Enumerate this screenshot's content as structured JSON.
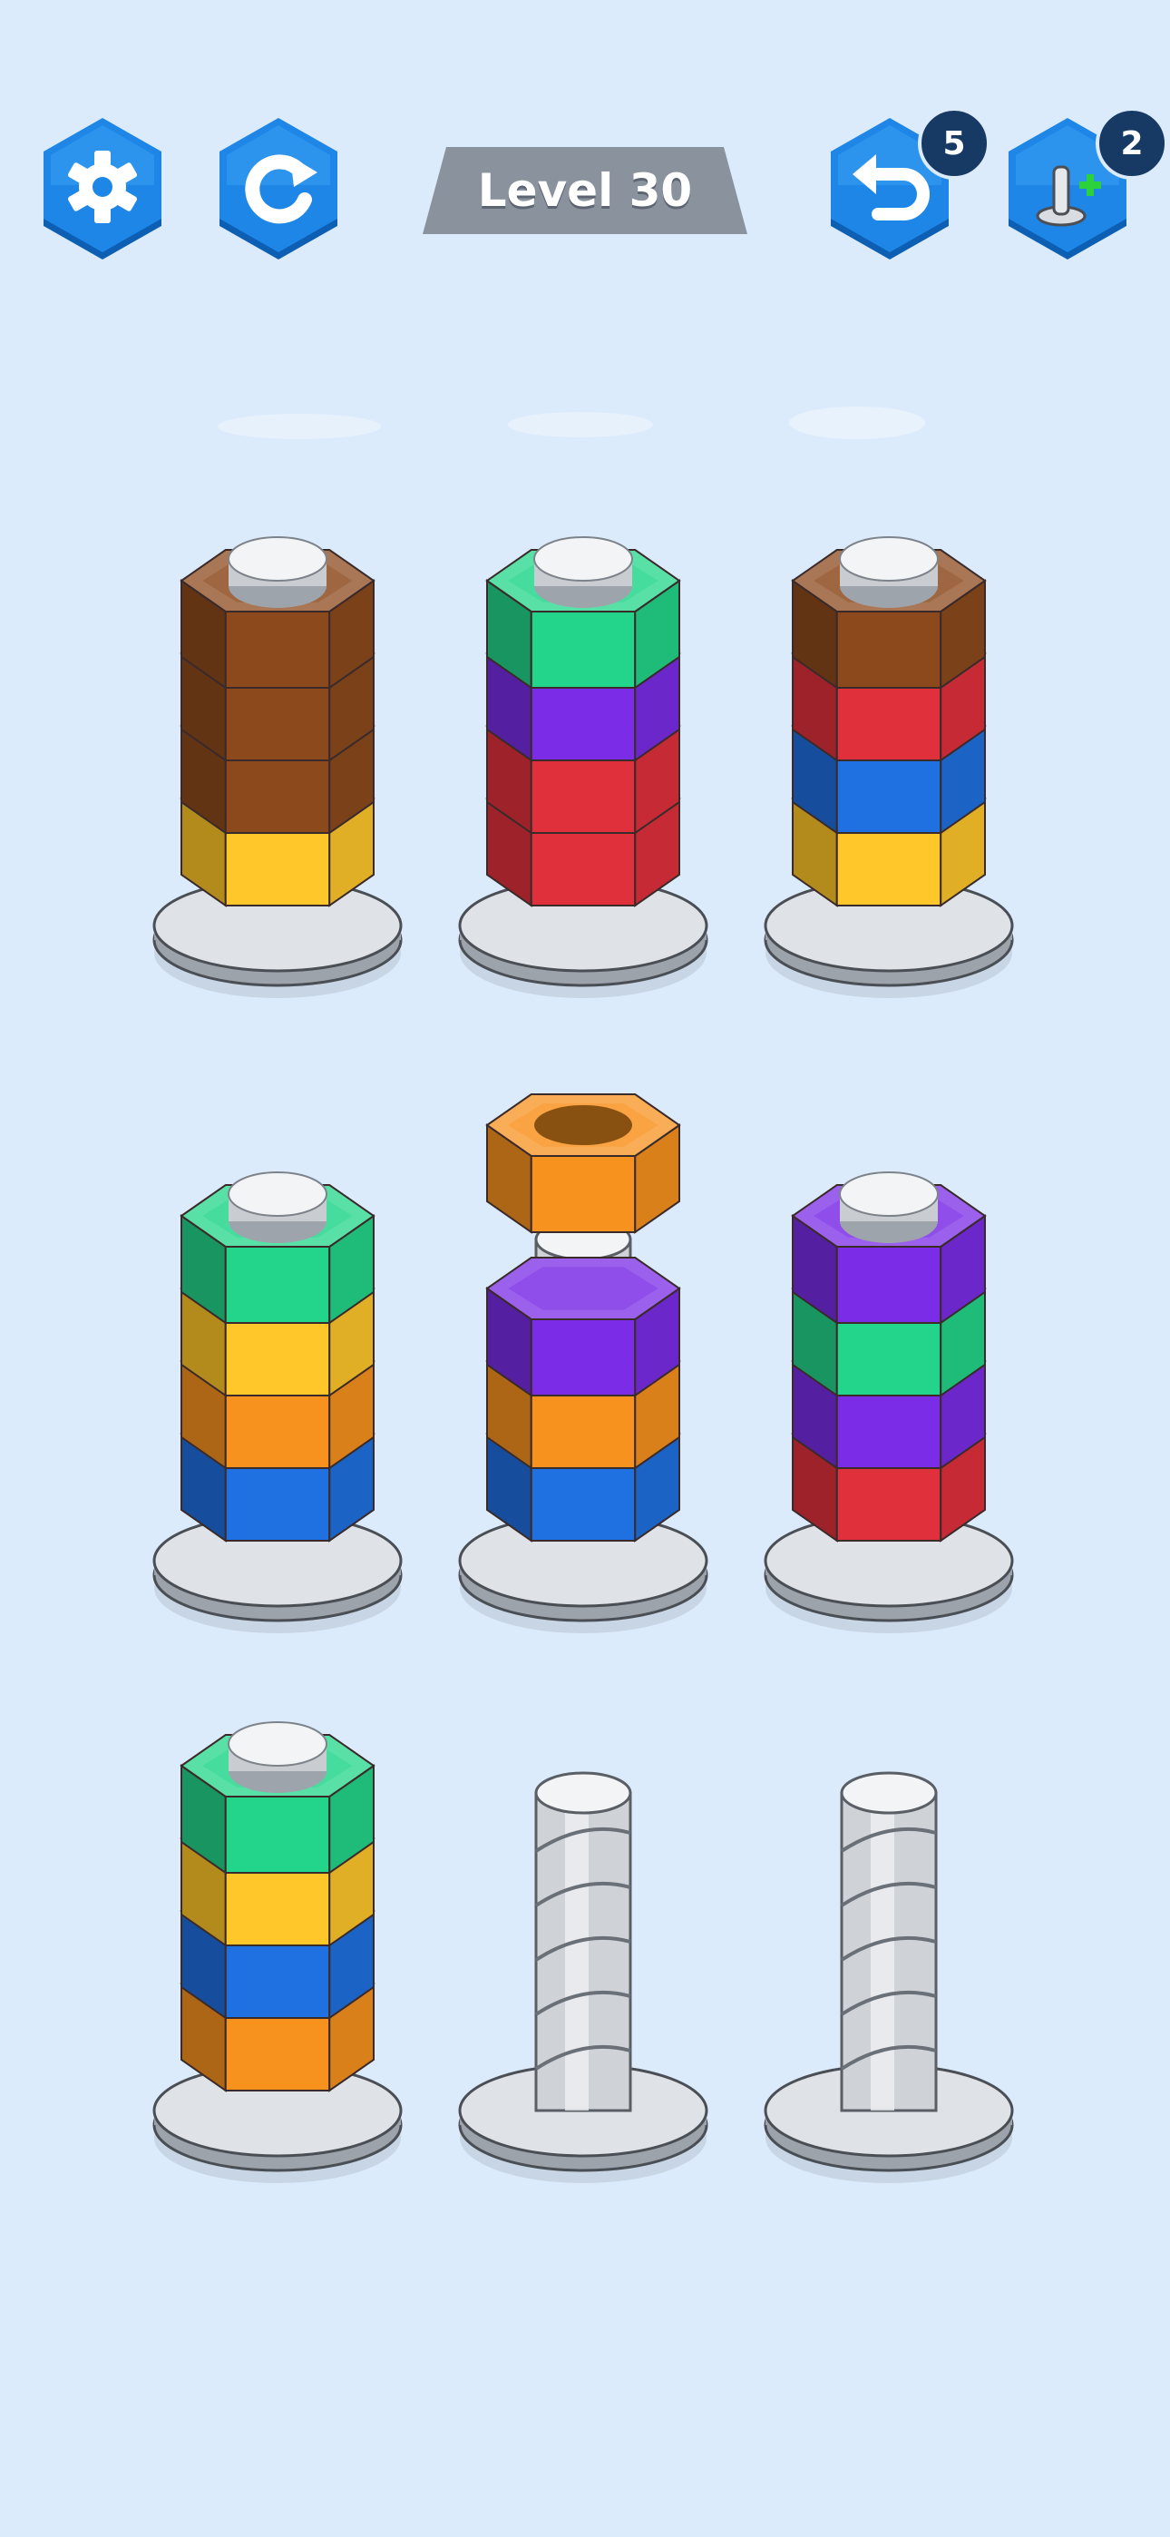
{
  "hud": {
    "settings_icon": "gear-icon",
    "restart_icon": "restart-icon",
    "undo_icon": "undo-icon",
    "undo_count": "5",
    "add_screw_icon": "add-screw-icon",
    "add_screw_count": "2",
    "level_label": "Level 30"
  },
  "colors": {
    "background": "#dcebfb",
    "button_blue": "#1e7fe0",
    "badge": "#163a63",
    "banner": "#8a939d",
    "brown": "#8c4a1c",
    "yellow": "#ffc72a",
    "green": "#22d58a",
    "purple": "#7a2ce6",
    "red": "#e0303c",
    "blue": "#1f70e0",
    "orange": "#f7921e"
  },
  "screws": [
    {
      "id": "screw-1",
      "nuts": [
        "yellow",
        "brown",
        "brown",
        "brown"
      ]
    },
    {
      "id": "screw-2",
      "nuts": [
        "red",
        "red",
        "purple",
        "green"
      ]
    },
    {
      "id": "screw-3",
      "nuts": [
        "yellow",
        "blue",
        "red",
        "brown"
      ]
    },
    {
      "id": "screw-4",
      "nuts": [
        "blue",
        "orange",
        "yellow",
        "green"
      ]
    },
    {
      "id": "screw-5",
      "nuts": [
        "blue",
        "orange",
        "purple"
      ],
      "lifted": "orange"
    },
    {
      "id": "screw-6",
      "nuts": [
        "red",
        "purple",
        "green",
        "purple"
      ]
    },
    {
      "id": "screw-7",
      "nuts": [
        "orange",
        "blue",
        "yellow",
        "green"
      ]
    },
    {
      "id": "screw-8",
      "nuts": []
    },
    {
      "id": "screw-9",
      "nuts": []
    }
  ]
}
